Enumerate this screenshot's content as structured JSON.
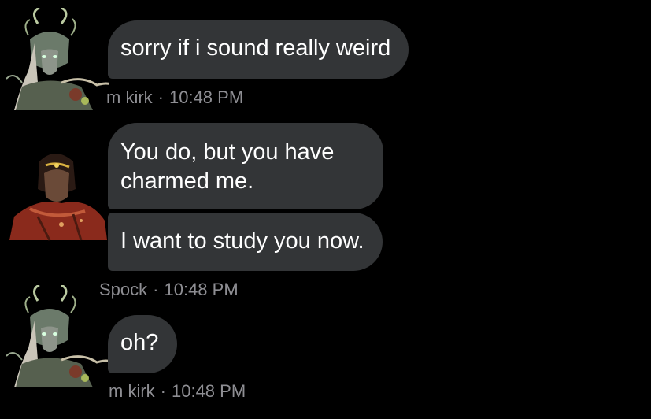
{
  "colors": {
    "background": "#000000",
    "bubble": "#333537",
    "text": "#ffffff",
    "meta": "#8e8e93"
  },
  "messages": [
    {
      "avatar_icon": "horned-character-avatar-icon",
      "bubbles": [
        "sorry if i sound really weird"
      ],
      "sender": "m kirk",
      "separator": "·",
      "time": "10:48 PM"
    },
    {
      "avatar_icon": "hooded-character-avatar-icon",
      "bubbles": [
        {
          "line1": "You do, but you have",
          "line2": "charmed me."
        },
        "I want to study you now."
      ],
      "sender": "Spock",
      "separator": "·",
      "time": "10:48 PM"
    },
    {
      "avatar_icon": "horned-character-avatar-icon",
      "bubbles": [
        "oh?"
      ],
      "sender": "m kirk",
      "separator": "·",
      "time": "10:48 PM"
    }
  ]
}
